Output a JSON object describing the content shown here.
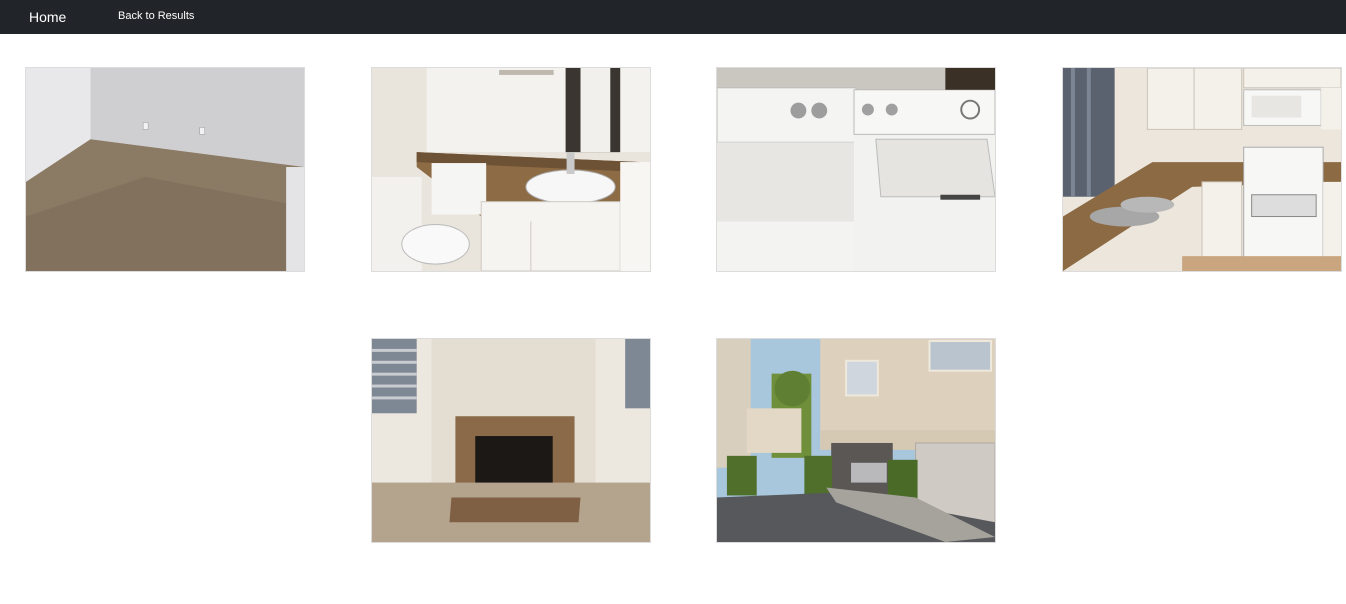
{
  "navbar": {
    "home_label": "Home",
    "back_label": "Back to Results",
    "background": "#212529"
  },
  "gallery": {
    "photos": [
      {
        "subject": "empty carpeted bedroom"
      },
      {
        "subject": "bathroom with granite vanity and toilet"
      },
      {
        "subject": "washer and dryer"
      },
      {
        "subject": "kitchen with sink, cabinets and white stove"
      },
      {
        "subject": "fireplace with granite surround"
      },
      {
        "subject": "condo exterior with open garage"
      }
    ]
  }
}
